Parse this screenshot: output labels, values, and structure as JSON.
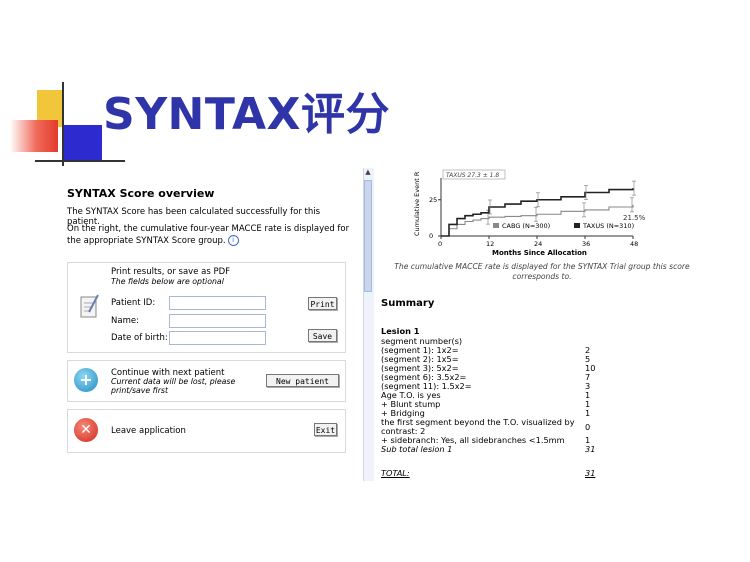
{
  "slide": {
    "title": "SYNTAX评分"
  },
  "overview": {
    "heading": "SYNTAX Score overview",
    "para1": "The SYNTAX Score has been calculated successfully for this patient.",
    "para2": "On the right, the cumulative four-year MACCE rate is displayed for the appropriate SYNTAX Score group.",
    "info_icon": "i"
  },
  "print_box": {
    "heading": "Print results, or save as PDF",
    "subheading": "The fields below are optional",
    "patient_id_label": "Patient ID:",
    "name_label": "Name:",
    "dob_label": "Date of birth:",
    "print_button": "Print",
    "save_button": "Save",
    "patient_id_value": "",
    "name_value": "",
    "dob_value": ""
  },
  "next_box": {
    "heading": "Continue with next patient",
    "note": "Current data will be lost, please print/save first",
    "button": "New patient",
    "icon_glyph": "+"
  },
  "leave_box": {
    "label": "Leave application",
    "button": "Exit",
    "icon_glyph": "✕"
  },
  "chart_data": {
    "type": "line",
    "ylabel": "Cumulative Event R",
    "xlabel": "Months Since Allocation",
    "xlim": [
      0,
      48
    ],
    "ylim": [
      0,
      40
    ],
    "xticks": [
      0,
      12,
      24,
      36,
      48
    ],
    "yticks": [
      0,
      25
    ],
    "series": [
      {
        "name": "CABG (N=300)",
        "color": "#888888",
        "x": [
          0,
          2,
          4,
          6,
          8,
          10,
          12,
          16,
          20,
          24,
          30,
          36,
          42,
          48
        ],
        "y": [
          0,
          5,
          8,
          10,
          11,
          12,
          13,
          13.5,
          14,
          15,
          17,
          18,
          20,
          21.5
        ]
      },
      {
        "name": "TAXUS (N=310)",
        "color": "#222222",
        "x": [
          0,
          2,
          4,
          6,
          8,
          10,
          12,
          16,
          20,
          24,
          30,
          36,
          42,
          48
        ],
        "y": [
          0,
          8,
          12,
          14,
          15,
          16,
          20,
          22,
          24,
          25,
          27,
          30,
          32,
          33
        ]
      }
    ],
    "annotations": [
      "TAXUS 27.3 ± 1.8",
      "21.5%"
    ]
  },
  "chart_caption": "The cumulative MACCE rate is displayed for the SYNTAX Trial group this score corresponds to.",
  "summary": {
    "heading": "Summary",
    "lesion": "Lesion 1",
    "rows": [
      {
        "label": "segment number(s)",
        "value": ""
      },
      {
        "label": "(segment 1): 1x2=",
        "value": "2"
      },
      {
        "label": "(segment 2): 1x5=",
        "value": "5"
      },
      {
        "label": "(segment 3): 5x2=",
        "value": "10"
      },
      {
        "label": "(segment 6): 3.5x2=",
        "value": "7"
      },
      {
        "label": "(segment 11): 1.5x2=",
        "value": "3"
      },
      {
        "label": "Age T.O. is yes",
        "value": "1"
      },
      {
        "label": "+ Blunt stump",
        "value": "1"
      },
      {
        "label": "+ Bridging",
        "value": "1"
      },
      {
        "label": "the first segment beyond the T.O. visualized by contrast: 2",
        "value": "0"
      },
      {
        "label": "+ sidebranch: Yes, all sidebranches <1.5mm",
        "value": "1"
      },
      {
        "label": "Sub total lesion 1",
        "value": "31"
      }
    ],
    "total_label": "TOTAL:",
    "total_value": "31"
  }
}
